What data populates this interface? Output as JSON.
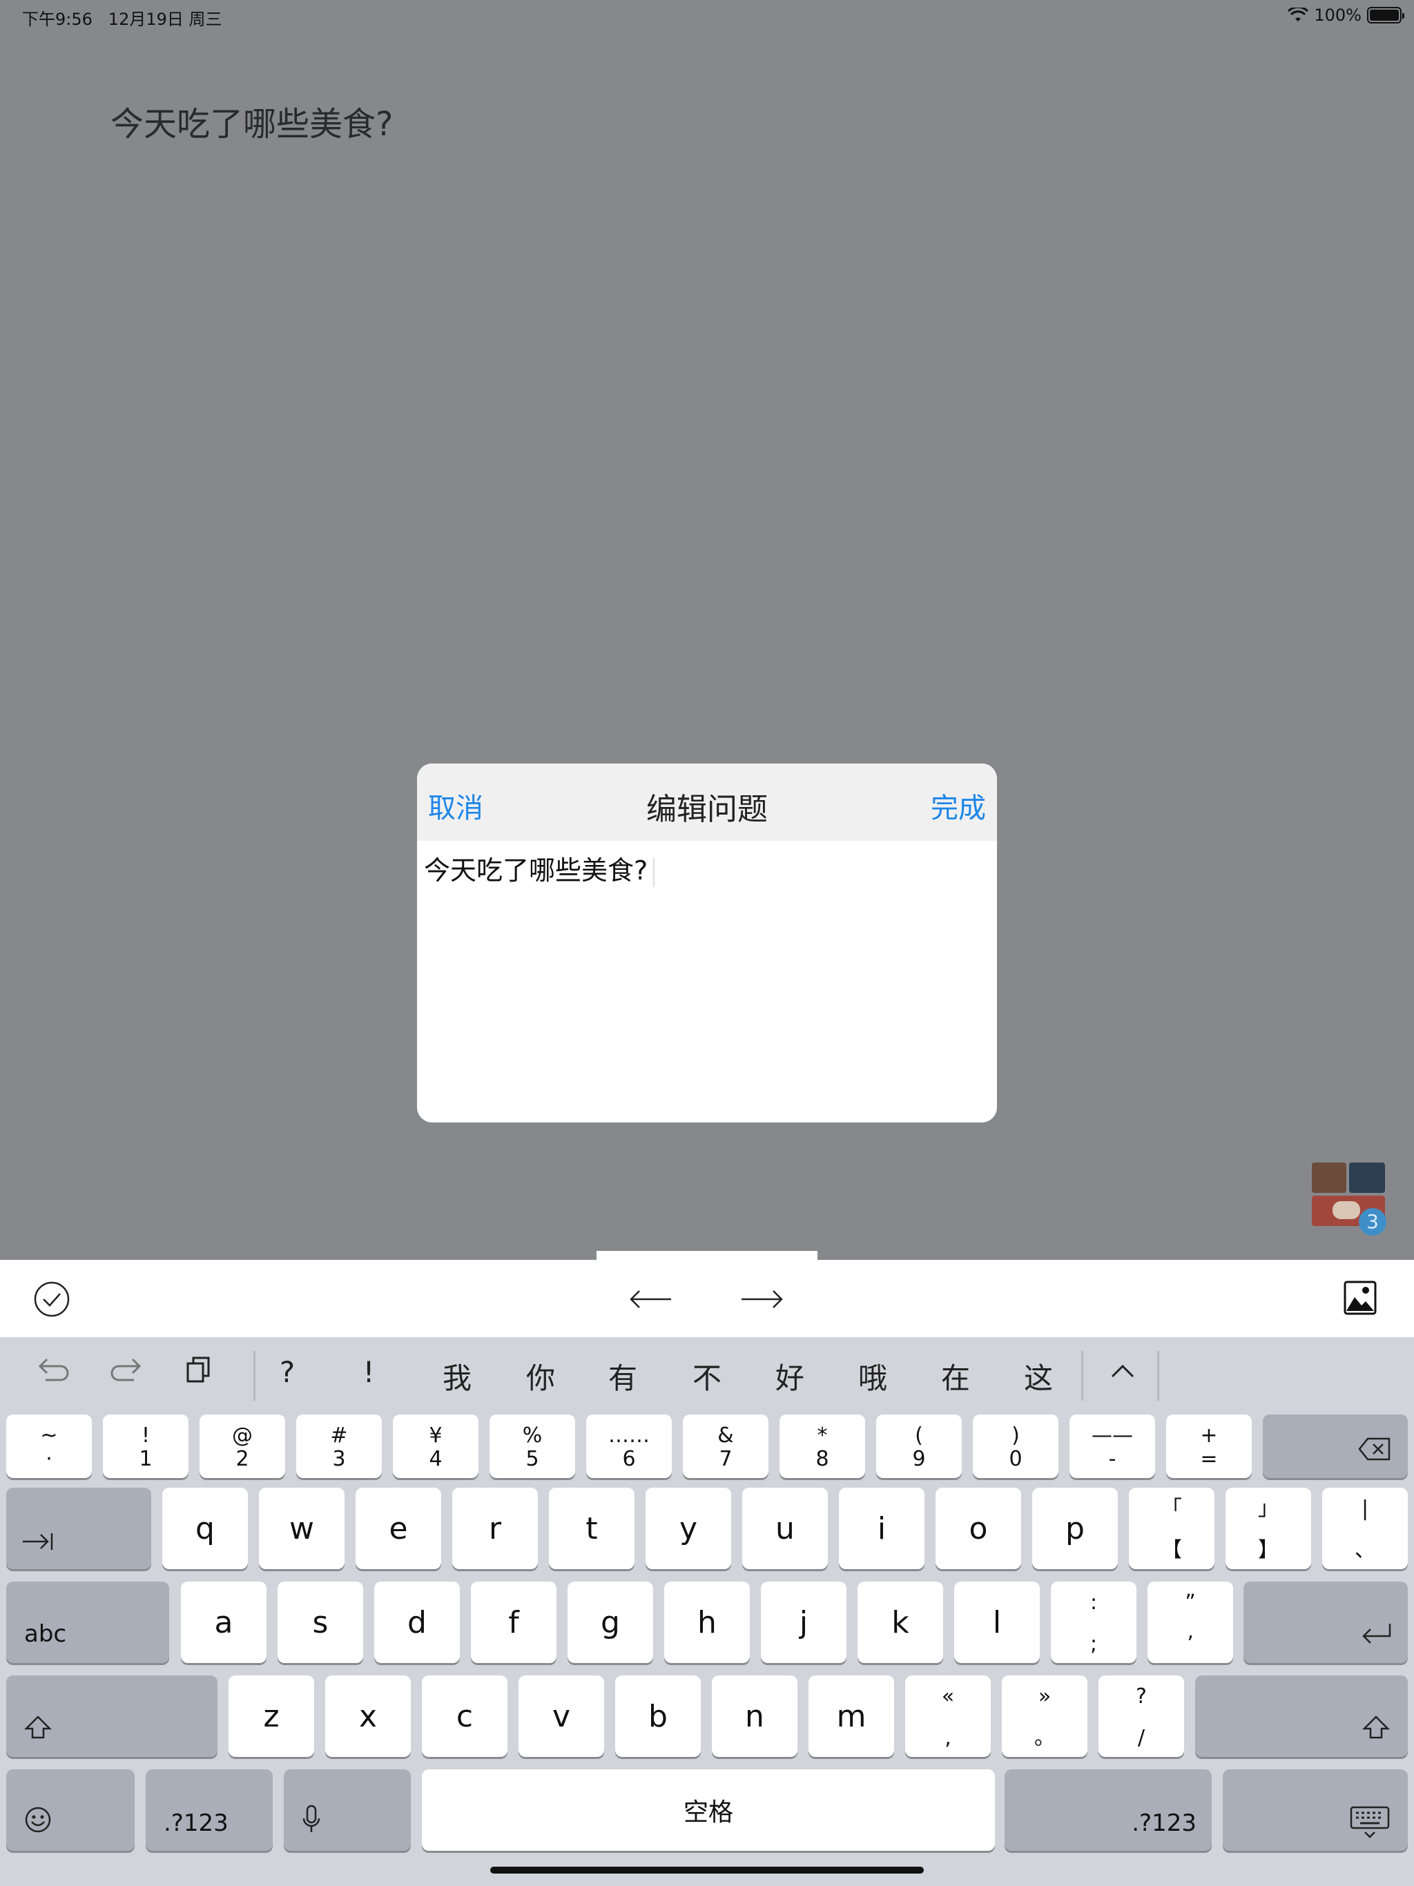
{
  "status_bar": {
    "time": "下午9:56",
    "date": "12月19日 周三",
    "battery": "100%"
  },
  "background": {
    "question": "今天吃了哪些美食?"
  },
  "dialog": {
    "cancel": "取消",
    "title": "编辑问题",
    "done": "完成",
    "text": "今天吃了哪些美食?"
  },
  "thumbnail": {
    "badge": "3"
  },
  "toolbar": {
    "icons": [
      "checkmark-circle-icon",
      "arrow-left-icon",
      "arrow-right-icon",
      "image-icon"
    ]
  },
  "keyboard": {
    "suggestions": [
      "?",
      "!",
      "我",
      "你",
      "有",
      "不",
      "好",
      "哦",
      "在",
      "这"
    ],
    "row1": [
      [
        "~",
        "·"
      ],
      [
        "!",
        "1"
      ],
      [
        "@",
        "2"
      ],
      [
        "#",
        "3"
      ],
      [
        "¥",
        "4"
      ],
      [
        "%",
        "5"
      ],
      [
        "……",
        "6"
      ],
      [
        "&",
        "7"
      ],
      [
        "*",
        "8"
      ],
      [
        "(",
        "9"
      ],
      [
        ")",
        "0"
      ],
      [
        "——",
        "-"
      ],
      [
        "+",
        "="
      ]
    ],
    "row2": [
      "q",
      "w",
      "e",
      "r",
      "t",
      "y",
      "u",
      "i",
      "o",
      "p"
    ],
    "row2_extra": [
      [
        "「",
        "【"
      ],
      [
        "」",
        "】"
      ],
      [
        "|",
        "、"
      ]
    ],
    "row3": [
      "a",
      "s",
      "d",
      "f",
      "g",
      "h",
      "j",
      "k",
      "l"
    ],
    "row3_extra": [
      [
        ":",
        ";"
      ],
      [
        "”",
        "’"
      ]
    ],
    "row4": [
      "z",
      "x",
      "c",
      "v",
      "b",
      "n",
      "m"
    ],
    "row4_extra": [
      [
        "«",
        ","
      ],
      [
        "»",
        "。"
      ],
      [
        "?",
        "/"
      ]
    ],
    "abc": "abc",
    "numbers": ".?123",
    "space": "空格"
  }
}
